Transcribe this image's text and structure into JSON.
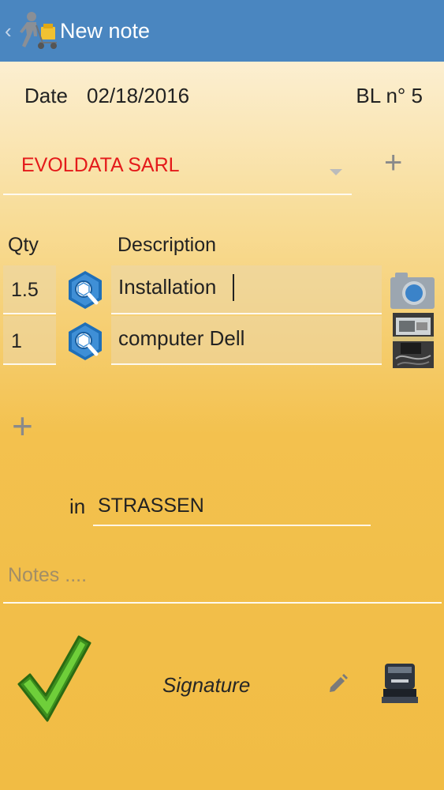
{
  "appbar": {
    "title": "New note",
    "back_icon": "chevron-left-icon",
    "app_icon": "delivery-man-icon",
    "color": "#4a86c0"
  },
  "header": {
    "date_label": "Date",
    "date_value": "02/18/2016",
    "bl_label": "BL n° 5"
  },
  "customer": {
    "selected": "EVOLDATA SARL",
    "color": "#e41a1a"
  },
  "lines": {
    "qty_header": "Qty",
    "description_header": "Description",
    "items": [
      {
        "qty": "1.5",
        "description": "Installation",
        "media": "camera-icon"
      },
      {
        "qty": "1",
        "description": "computer Dell",
        "media": "photo-thumbnail"
      }
    ]
  },
  "location": {
    "in_label": "in",
    "city": "STRASSEN"
  },
  "notes": {
    "placeholder": "Notes ...."
  },
  "footer": {
    "signature_label": "Signature",
    "validate_icon": "checkmark-icon",
    "edit_icon": "pencil-icon",
    "stamp_icon": "stamp-icon"
  }
}
